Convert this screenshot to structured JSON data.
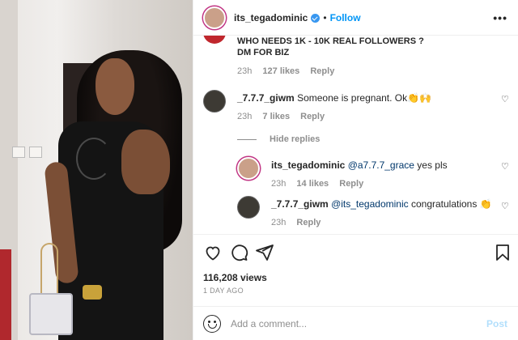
{
  "header": {
    "username": "its_tegadominic",
    "separator": "•",
    "follow_label": "Follow",
    "more_label": "•••"
  },
  "comments": [
    {
      "username": "",
      "text_line1": "WHO NEEDS 1K - 10K REAL FOLLOWERS ?",
      "text_line2": "DM FOR BIZ",
      "time": "23h",
      "likes": "127 likes",
      "reply_label": "Reply"
    },
    {
      "username": "_7.7.7_giwm",
      "text": "Someone is pregnant. Ok",
      "emoji": "👏🙌",
      "time": "23h",
      "likes": "7 likes",
      "reply_label": "Reply"
    }
  ],
  "hide_replies_label": "Hide replies",
  "replies": [
    {
      "username": "its_tegadominic",
      "mention": "@a7.7.7_grace",
      "text": "yes pls",
      "time": "23h",
      "likes": "14 likes",
      "reply_label": "Reply"
    },
    {
      "username": "_7.7.7_giwm",
      "mention": "@its_tegadominic",
      "text": "congratulations",
      "emoji": "👏",
      "time": "23h",
      "reply_label": "Reply"
    }
  ],
  "actions": {
    "views": "116,208 views",
    "posted": "1 DAY AGO"
  },
  "composer": {
    "placeholder": "Add a comment...",
    "post_label": "Post"
  },
  "colors": {
    "link_blue": "#0095f6",
    "meta_gray": "#8e8e8e",
    "post_disabled": "#b2dffc"
  }
}
